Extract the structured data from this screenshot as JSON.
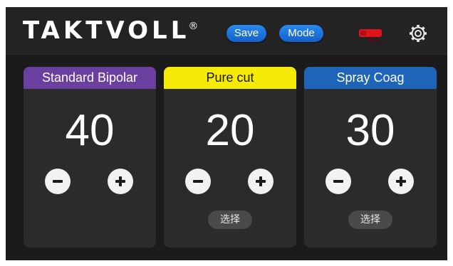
{
  "header": {
    "brand": "TAKTVOLL",
    "brand_mark": "®",
    "save_label": "Save",
    "mode_label": "Mode",
    "plug_icon": "plug-icon",
    "settings_icon": "gear-icon"
  },
  "panels": [
    {
      "title": "Standard Bipolar",
      "value": "40",
      "color": "#6b3fa0"
    },
    {
      "title": "Pure cut",
      "value": "20",
      "color": "#f6ea07",
      "select_label": "选择"
    },
    {
      "title": "Spray Coag",
      "value": "30",
      "color": "#1e65b9",
      "select_label": "选择"
    }
  ],
  "colors": {
    "accent": "#1e6fd9",
    "background": "#1b1b1b",
    "panel": "#2b2b2b",
    "plug": "#e0141c"
  }
}
